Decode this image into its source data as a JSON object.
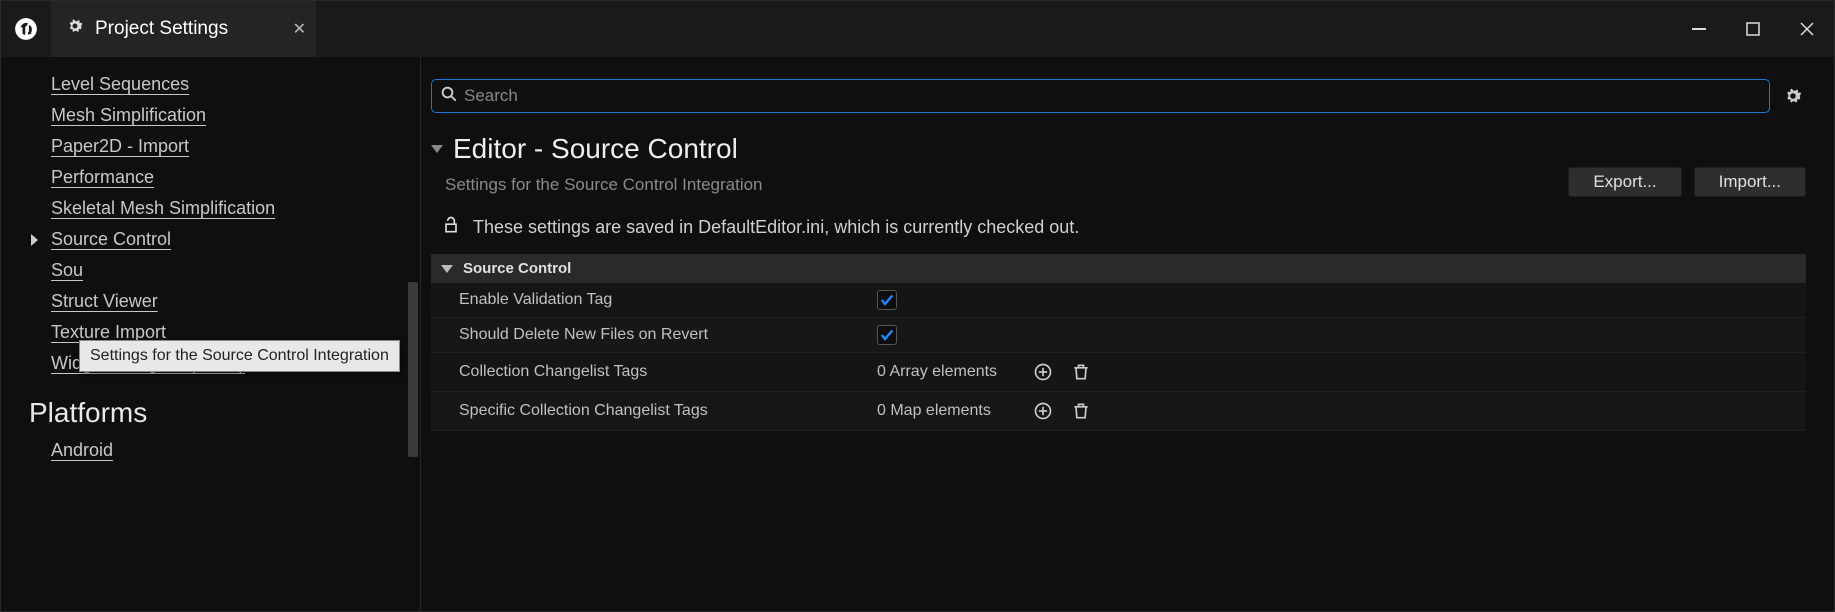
{
  "window": {
    "tab_title": "Project Settings"
  },
  "sidebar": {
    "items": [
      {
        "label": "Level Sequences"
      },
      {
        "label": "Mesh Simplification"
      },
      {
        "label": "Paper2D - Import"
      },
      {
        "label": "Performance"
      },
      {
        "label": "Skeletal Mesh Simplification"
      },
      {
        "label": "Source Control",
        "selected": true
      },
      {
        "label": "Sou"
      },
      {
        "label": "Struct Viewer"
      },
      {
        "label": "Texture Import"
      },
      {
        "label": "Widget Designer (Team)"
      }
    ],
    "section_header": "Platforms",
    "after_items": [
      {
        "label": "Android"
      }
    ],
    "tooltip": "Settings for the Source Control Integration"
  },
  "search": {
    "placeholder": "Search"
  },
  "page": {
    "title": "Editor - Source Control",
    "subtitle": "Settings for the Source Control Integration",
    "export_label": "Export...",
    "import_label": "Import...",
    "save_note": "These settings are saved in DefaultEditor.ini, which is currently checked out."
  },
  "section": {
    "title": "Source Control"
  },
  "props": {
    "enable_validation_tag": {
      "label": "Enable Validation Tag",
      "checked": true
    },
    "should_delete_new_files": {
      "label": "Should Delete New Files on Revert",
      "checked": true
    },
    "collection_changelist_tags": {
      "label": "Collection Changelist Tags",
      "value": "0 Array elements"
    },
    "specific_collection_changelist_tags": {
      "label": "Specific Collection Changelist Tags",
      "value": "0 Map elements"
    }
  }
}
